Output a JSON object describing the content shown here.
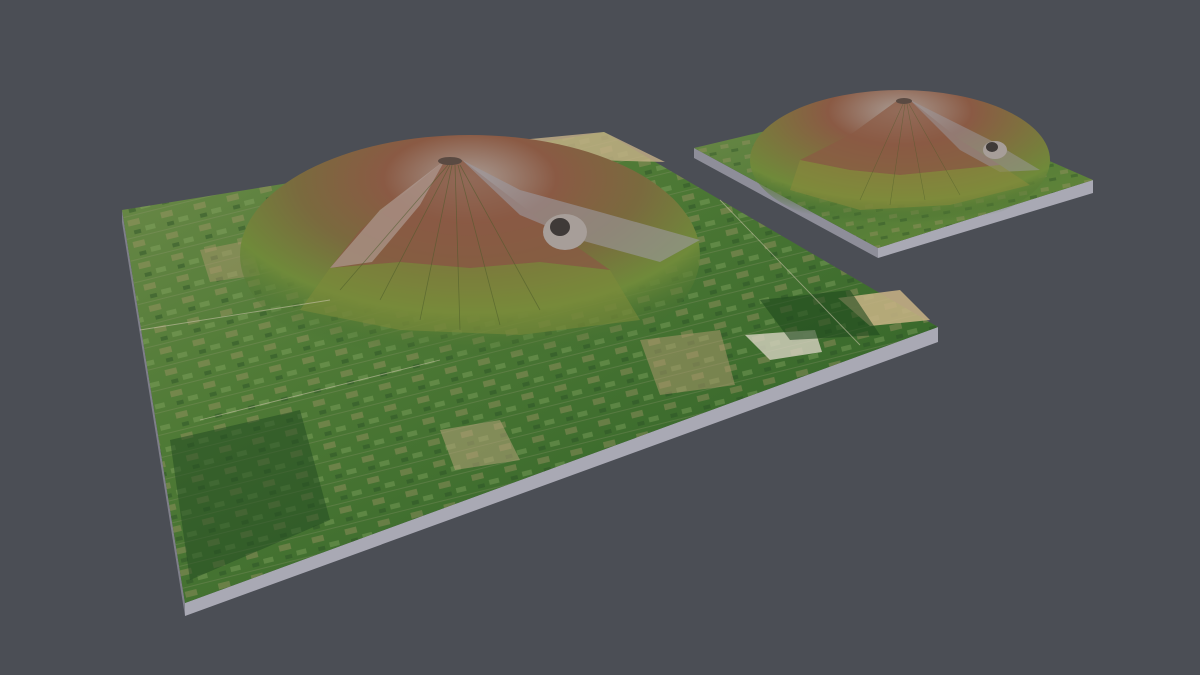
{
  "scene": {
    "background_color": "#4b4e55",
    "base_side_color": "#8e8e99",
    "base_front_color": "#a9a9b4",
    "vegetation_dark": "#2f5a2b",
    "vegetation_light": "#5f8a3a",
    "farmland_tan": "#b29a70",
    "slope_olive": "#8a8a3c",
    "summit_rust": "#8a5a44",
    "summit_grey": "#9c9088",
    "models": [
      {
        "name": "large-terrain-model"
      },
      {
        "name": "small-terrain-model"
      }
    ]
  }
}
